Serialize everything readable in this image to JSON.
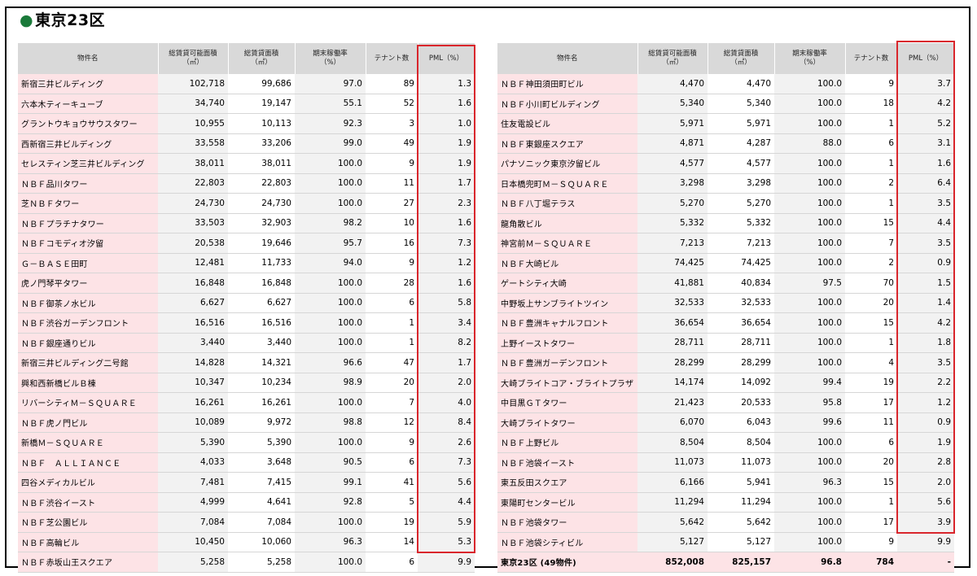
{
  "title": {
    "bullet": "●",
    "text": "東京23区"
  },
  "headers": {
    "name": "物件名",
    "leasable": "総賃貸可能面積\n（㎡）",
    "leased": "総賃貸面積\n（㎡）",
    "occupancy": "期末稼働率\n（%）",
    "tenants": "テナント数",
    "pml": "PML（%）"
  },
  "left_rows": [
    {
      "name": "新宿三井ビルディング",
      "leasable": "102,718",
      "leased": "99,686",
      "occupancy": "97.0",
      "tenants": "89",
      "pml": "1.3"
    },
    {
      "name": "六本木ティーキューブ",
      "leasable": "34,740",
      "leased": "19,147",
      "occupancy": "55.1",
      "tenants": "52",
      "pml": "1.6"
    },
    {
      "name": "グラントウキョウサウスタワー",
      "leasable": "10,955",
      "leased": "10,113",
      "occupancy": "92.3",
      "tenants": "3",
      "pml": "1.0"
    },
    {
      "name": "西新宿三井ビルディング",
      "leasable": "33,558",
      "leased": "33,206",
      "occupancy": "99.0",
      "tenants": "49",
      "pml": "1.9"
    },
    {
      "name": "セレスティン芝三井ビルディング",
      "leasable": "38,011",
      "leased": "38,011",
      "occupancy": "100.0",
      "tenants": "9",
      "pml": "1.9"
    },
    {
      "name": "ＮＢＦ品川タワー",
      "leasable": "22,803",
      "leased": "22,803",
      "occupancy": "100.0",
      "tenants": "11",
      "pml": "1.7"
    },
    {
      "name": "芝ＮＢＦタワー",
      "leasable": "24,730",
      "leased": "24,730",
      "occupancy": "100.0",
      "tenants": "27",
      "pml": "2.3"
    },
    {
      "name": "ＮＢＦプラチナタワー",
      "leasable": "33,503",
      "leased": "32,903",
      "occupancy": "98.2",
      "tenants": "10",
      "pml": "1.6"
    },
    {
      "name": "ＮＢＦコモディオ汐留",
      "leasable": "20,538",
      "leased": "19,646",
      "occupancy": "95.7",
      "tenants": "16",
      "pml": "7.3"
    },
    {
      "name": "Ｇ－ＢＡＳＥ田町",
      "leasable": "12,481",
      "leased": "11,733",
      "occupancy": "94.0",
      "tenants": "9",
      "pml": "1.2"
    },
    {
      "name": "虎ノ門琴平タワー",
      "leasable": "16,848",
      "leased": "16,848",
      "occupancy": "100.0",
      "tenants": "28",
      "pml": "1.6"
    },
    {
      "name": "ＮＢＦ御茶ノ水ビル",
      "leasable": "6,627",
      "leased": "6,627",
      "occupancy": "100.0",
      "tenants": "6",
      "pml": "5.8"
    },
    {
      "name": "ＮＢＦ渋谷ガーデンフロント",
      "leasable": "16,516",
      "leased": "16,516",
      "occupancy": "100.0",
      "tenants": "1",
      "pml": "3.4"
    },
    {
      "name": "ＮＢＦ銀座通りビル",
      "leasable": "3,440",
      "leased": "3,440",
      "occupancy": "100.0",
      "tenants": "1",
      "pml": "8.2"
    },
    {
      "name": "新宿三井ビルディング二号館",
      "leasable": "14,828",
      "leased": "14,321",
      "occupancy": "96.6",
      "tenants": "47",
      "pml": "1.7"
    },
    {
      "name": "興和西新橋ビルＢ棟",
      "leasable": "10,347",
      "leased": "10,234",
      "occupancy": "98.9",
      "tenants": "20",
      "pml": "2.0"
    },
    {
      "name": "リバーシティＭ－ＳＱＵＡＲＥ",
      "leasable": "16,261",
      "leased": "16,261",
      "occupancy": "100.0",
      "tenants": "7",
      "pml": "4.0"
    },
    {
      "name": "ＮＢＦ虎ノ門ビル",
      "leasable": "10,089",
      "leased": "9,972",
      "occupancy": "98.8",
      "tenants": "12",
      "pml": "8.4"
    },
    {
      "name": "新橋Ｍ－ＳＱＵＡＲＥ",
      "leasable": "5,390",
      "leased": "5,390",
      "occupancy": "100.0",
      "tenants": "9",
      "pml": "2.6"
    },
    {
      "name": "ＮＢＦ　ＡＬＬＩＡＮＣＥ",
      "leasable": "4,033",
      "leased": "3,648",
      "occupancy": "90.5",
      "tenants": "6",
      "pml": "7.3"
    },
    {
      "name": "四谷メディカルビル",
      "leasable": "7,481",
      "leased": "7,415",
      "occupancy": "99.1",
      "tenants": "41",
      "pml": "5.6"
    },
    {
      "name": "ＮＢＦ渋谷イースト",
      "leasable": "4,999",
      "leased": "4,641",
      "occupancy": "92.8",
      "tenants": "5",
      "pml": "4.4"
    },
    {
      "name": "ＮＢＦ芝公園ビル",
      "leasable": "7,084",
      "leased": "7,084",
      "occupancy": "100.0",
      "tenants": "19",
      "pml": "5.9"
    },
    {
      "name": "ＮＢＦ高輪ビル",
      "leasable": "10,450",
      "leased": "10,060",
      "occupancy": "96.3",
      "tenants": "14",
      "pml": "5.3"
    },
    {
      "name": "ＮＢＦ赤坂山王スクエア",
      "leasable": "5,258",
      "leased": "5,258",
      "occupancy": "100.0",
      "tenants": "6",
      "pml": "9.9"
    }
  ],
  "right_rows": [
    {
      "name": "ＮＢＦ神田須田町ビル",
      "leasable": "4,470",
      "leased": "4,470",
      "occupancy": "100.0",
      "tenants": "9",
      "pml": "3.7"
    },
    {
      "name": "ＮＢＦ小川町ビルディング",
      "leasable": "5,340",
      "leased": "5,340",
      "occupancy": "100.0",
      "tenants": "18",
      "pml": "4.2"
    },
    {
      "name": "住友電設ビル",
      "leasable": "5,971",
      "leased": "5,971",
      "occupancy": "100.0",
      "tenants": "1",
      "pml": "5.2"
    },
    {
      "name": "ＮＢＦ東銀座スクエア",
      "leasable": "4,871",
      "leased": "4,287",
      "occupancy": "88.0",
      "tenants": "6",
      "pml": "3.1"
    },
    {
      "name": "パナソニック東京汐留ビル",
      "leasable": "4,577",
      "leased": "4,577",
      "occupancy": "100.0",
      "tenants": "1",
      "pml": "1.6"
    },
    {
      "name": "日本橋兜町Ｍ－ＳＱＵＡＲＥ",
      "leasable": "3,298",
      "leased": "3,298",
      "occupancy": "100.0",
      "tenants": "2",
      "pml": "6.4"
    },
    {
      "name": "ＮＢＦ八丁堀テラス",
      "leasable": "5,270",
      "leased": "5,270",
      "occupancy": "100.0",
      "tenants": "1",
      "pml": "3.5"
    },
    {
      "name": "龍角散ビル",
      "leasable": "5,332",
      "leased": "5,332",
      "occupancy": "100.0",
      "tenants": "15",
      "pml": "4.4"
    },
    {
      "name": "神宮前Ｍ－ＳＱＵＡＲＥ",
      "leasable": "7,213",
      "leased": "7,213",
      "occupancy": "100.0",
      "tenants": "7",
      "pml": "3.5"
    },
    {
      "name": "ＮＢＦ大崎ビル",
      "leasable": "74,425",
      "leased": "74,425",
      "occupancy": "100.0",
      "tenants": "2",
      "pml": "0.9"
    },
    {
      "name": "ゲートシティ大崎",
      "leasable": "41,881",
      "leased": "40,834",
      "occupancy": "97.5",
      "tenants": "70",
      "pml": "1.5"
    },
    {
      "name": "中野坂上サンブライトツイン",
      "leasable": "32,533",
      "leased": "32,533",
      "occupancy": "100.0",
      "tenants": "20",
      "pml": "1.4"
    },
    {
      "name": "ＮＢＦ豊洲キャナルフロント",
      "leasable": "36,654",
      "leased": "36,654",
      "occupancy": "100.0",
      "tenants": "15",
      "pml": "4.2"
    },
    {
      "name": "上野イーストタワー",
      "leasable": "28,711",
      "leased": "28,711",
      "occupancy": "100.0",
      "tenants": "1",
      "pml": "1.8"
    },
    {
      "name": "ＮＢＦ豊洲ガーデンフロント",
      "leasable": "28,299",
      "leased": "28,299",
      "occupancy": "100.0",
      "tenants": "4",
      "pml": "3.5"
    },
    {
      "name": "大崎ブライトコア・ブライトプラザ",
      "leasable": "14,174",
      "leased": "14,092",
      "occupancy": "99.4",
      "tenants": "19",
      "pml": "2.2"
    },
    {
      "name": "中目黒ＧＴタワー",
      "leasable": "21,423",
      "leased": "20,533",
      "occupancy": "95.8",
      "tenants": "17",
      "pml": "1.2"
    },
    {
      "name": "大崎ブライトタワー",
      "leasable": "6,070",
      "leased": "6,043",
      "occupancy": "99.6",
      "tenants": "11",
      "pml": "0.9"
    },
    {
      "name": "ＮＢＦ上野ビル",
      "leasable": "8,504",
      "leased": "8,504",
      "occupancy": "100.0",
      "tenants": "6",
      "pml": "1.9"
    },
    {
      "name": "ＮＢＦ池袋イースト",
      "leasable": "11,073",
      "leased": "11,073",
      "occupancy": "100.0",
      "tenants": "20",
      "pml": "2.8"
    },
    {
      "name": "東五反田スクエア",
      "leasable": "6,166",
      "leased": "5,941",
      "occupancy": "96.3",
      "tenants": "15",
      "pml": "2.0"
    },
    {
      "name": "東陽町センタービル",
      "leasable": "11,294",
      "leased": "11,294",
      "occupancy": "100.0",
      "tenants": "1",
      "pml": "5.6"
    },
    {
      "name": "ＮＢＦ池袋タワー",
      "leasable": "5,642",
      "leased": "5,642",
      "occupancy": "100.0",
      "tenants": "17",
      "pml": "3.9"
    },
    {
      "name": "ＮＢＦ池袋シティビル",
      "leasable": "5,127",
      "leased": "5,127",
      "occupancy": "100.0",
      "tenants": "9",
      "pml": "9.9"
    }
  ],
  "total_row": {
    "name": "東京23区 (49物件)",
    "leasable": "852,008",
    "leased": "825,157",
    "occupancy": "96.8",
    "tenants": "784",
    "pml": "-"
  },
  "colors": {
    "name_bg": "#fde3e6",
    "header_bg": "#d9d9d9",
    "highlight": "#d9262c",
    "bullet": "#1a7a3a"
  }
}
